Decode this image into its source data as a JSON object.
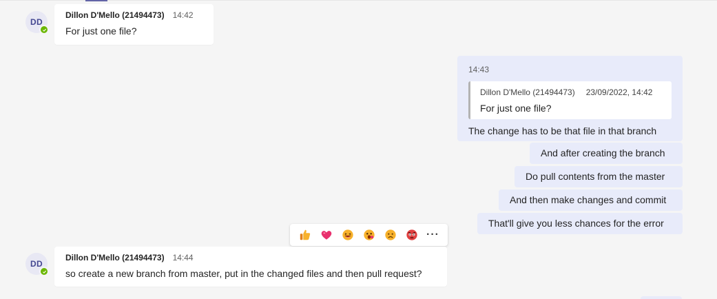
{
  "messages": {
    "first": {
      "avatar_initials": "DD",
      "author": "Dillon D'Mello (21494473)",
      "time": "14:42",
      "text": "For just one file?"
    },
    "reply": {
      "time": "14:43",
      "quote": {
        "author": "Dillon D'Mello (21494473)",
        "timestamp": "23/09/2022, 14:42",
        "text": "For just one file?"
      },
      "text": "The change has to be that file in that branch"
    },
    "followups": [
      "And after creating the branch",
      "Do pull contents from the master",
      "And then make changes and commit",
      "That'll give you less chances for the error"
    ],
    "second": {
      "avatar_initials": "DD",
      "author": "Dillon D'Mello (21494473)",
      "time": "14:44",
      "text": "so create a new branch from master, put in the changed files and then pull request?"
    }
  },
  "reactions": [
    "like",
    "heart",
    "laugh",
    "surprised",
    "sad",
    "angry"
  ],
  "more_label": "···",
  "colors": {
    "accent": "#6264a7",
    "outgoing_bubble": "#e8ebfa",
    "incoming_bubble": "#ffffff",
    "presence_available": "#6bb700"
  }
}
